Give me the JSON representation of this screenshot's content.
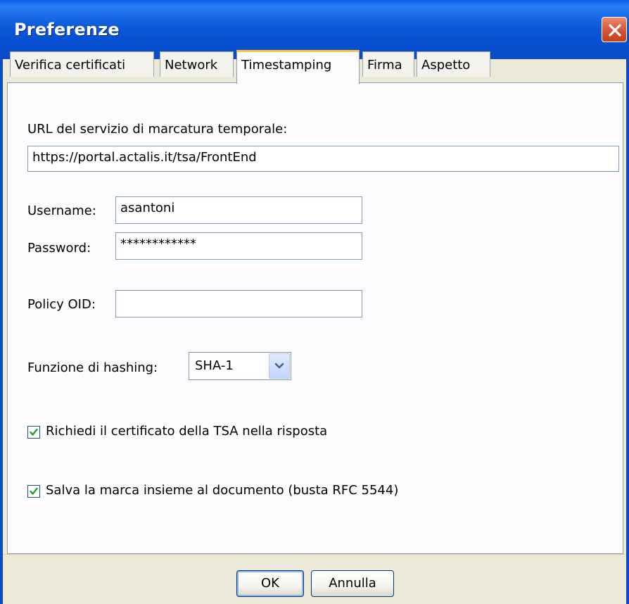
{
  "window": {
    "title": "Preferenze"
  },
  "tabs": [
    {
      "label": "Verifica certificati",
      "active": false
    },
    {
      "label": "Network",
      "active": false
    },
    {
      "label": "Timestamping",
      "active": true
    },
    {
      "label": "Firma",
      "active": false
    },
    {
      "label": "Aspetto",
      "active": false
    }
  ],
  "timestamping": {
    "url_label": "URL del servizio di marcatura temporale:",
    "url_value": "https://portal.actalis.it/tsa/FrontEnd",
    "username_label": "Username:",
    "username_value": "asantoni",
    "password_label": "Password:",
    "password_value": "************",
    "policy_label": "Policy OID:",
    "policy_value": "",
    "hashing_label": "Funzione di hashing:",
    "hashing_value": "SHA-1",
    "checkbox_tsa": {
      "label": "Richiedi il certificato della TSA nella risposta",
      "checked": true
    },
    "checkbox_save": {
      "label": "Salva la marca insieme al documento (busta RFC 5544)",
      "checked": true
    }
  },
  "buttons": {
    "ok": "OK",
    "cancel": "Annulla"
  },
  "icons": {
    "close": "close-icon",
    "dropdown": "chevron-down-icon",
    "check": "checkmark-icon"
  },
  "colors": {
    "titlebar": "#0a5fe8",
    "active_tab_accent": "#ffc83c",
    "close_button": "#d6573a"
  }
}
